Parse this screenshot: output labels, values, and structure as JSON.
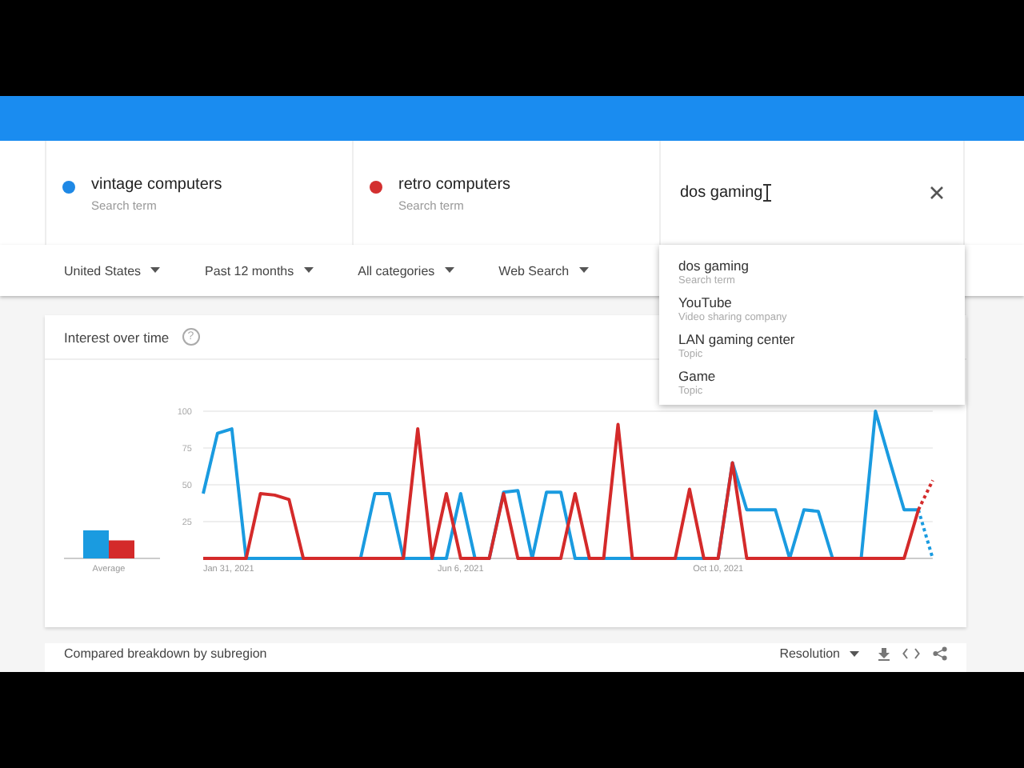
{
  "terms": [
    {
      "label": "vintage computers",
      "sublabel": "Search term",
      "color": "#1e88e5"
    },
    {
      "label": "retro computers",
      "sublabel": "Search term",
      "color": "#d32f2f"
    }
  ],
  "search": {
    "value": "dos gaming"
  },
  "suggestions": [
    {
      "label": "dos gaming",
      "sublabel": "Search term"
    },
    {
      "label": "YouTube",
      "sublabel": "Video sharing company"
    },
    {
      "label": "LAN gaming center",
      "sublabel": "Topic"
    },
    {
      "label": "Game",
      "sublabel": "Topic"
    }
  ],
  "filters": [
    "United States",
    "Past 12 months",
    "All categories",
    "Web Search"
  ],
  "interest_card": {
    "title": "Interest over time",
    "help": "?",
    "average_label": "Average",
    "x_labels": [
      "Jan 31, 2021",
      "Jun 6, 2021",
      "Oct 10, 2021"
    ],
    "chart_data": {
      "type": "line",
      "ylim": [
        0,
        100
      ],
      "yticks": [
        25,
        50,
        75,
        100
      ],
      "grid": true,
      "series": [
        {
          "color": "#1a9be0",
          "line_style": "dotted_last_segment",
          "values": [
            44,
            85,
            88,
            0,
            0,
            0,
            0,
            0,
            0,
            0,
            0,
            0,
            44,
            44,
            0,
            0,
            0,
            0,
            44,
            0,
            0,
            45,
            46,
            0,
            45,
            45,
            0,
            0,
            0,
            0,
            0,
            0,
            0,
            0,
            0,
            0,
            0,
            65,
            33,
            33,
            33,
            0,
            33,
            32,
            0,
            0,
            0,
            100,
            66,
            33,
            33,
            0
          ]
        },
        {
          "color": "#d42a2a",
          "line_style": "dotted_last_segment",
          "values": [
            0,
            0,
            0,
            0,
            44,
            43,
            40,
            0,
            0,
            0,
            0,
            0,
            0,
            0,
            0,
            88,
            0,
            44,
            0,
            0,
            0,
            44,
            0,
            0,
            0,
            0,
            44,
            0,
            0,
            91,
            0,
            0,
            0,
            0,
            47,
            0,
            0,
            65,
            0,
            0,
            0,
            0,
            0,
            0,
            0,
            0,
            0,
            0,
            0,
            0,
            33,
            53
          ]
        }
      ]
    }
  },
  "breakdown_card": {
    "title": "Compared breakdown by subregion",
    "resolution": "Resolution"
  }
}
